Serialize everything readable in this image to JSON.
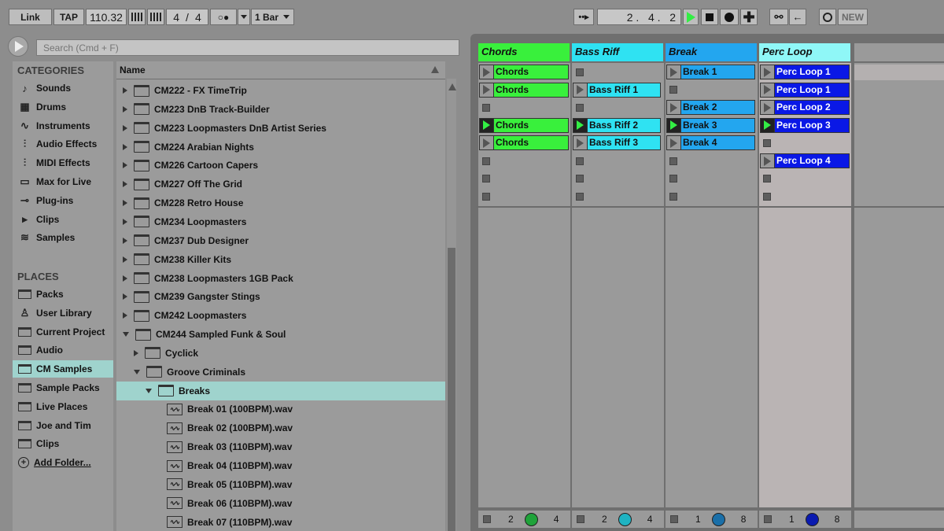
{
  "transport": {
    "link": "Link",
    "tap": "TAP",
    "tempo": "110.32",
    "signature_num": "4",
    "signature_sep": "/",
    "signature_den": "4",
    "quantize": "1 Bar",
    "position": "2 .   4 .   2",
    "new": "NEW"
  },
  "browser": {
    "search_placeholder": "Search (Cmd + F)",
    "categories_title": "CATEGORIES",
    "categories": [
      {
        "label": "Sounds",
        "icon": "♪"
      },
      {
        "label": "Drums",
        "icon": "▦"
      },
      {
        "label": "Instruments",
        "icon": "∿"
      },
      {
        "label": "Audio Effects",
        "icon": "⫶"
      },
      {
        "label": "MIDI Effects",
        "icon": "⫶"
      },
      {
        "label": "Max for Live",
        "icon": "▭"
      },
      {
        "label": "Plug-ins",
        "icon": "⊸"
      },
      {
        "label": "Clips",
        "icon": "▸"
      },
      {
        "label": "Samples",
        "icon": "≋"
      }
    ],
    "places_title": "PLACES",
    "places": [
      {
        "label": "Packs"
      },
      {
        "label": "User Library"
      },
      {
        "label": "Current Project"
      },
      {
        "label": "Audio"
      },
      {
        "label": "CM Samples"
      },
      {
        "label": "Sample Packs"
      },
      {
        "label": "Live Places"
      },
      {
        "label": "Joe and Tim"
      },
      {
        "label": "Clips"
      },
      {
        "label": "Add Folder..."
      }
    ],
    "list_header": "Name",
    "items": [
      {
        "label": "CM222 - FX TimeTrip"
      },
      {
        "label": "CM223 DnB Track-Builder"
      },
      {
        "label": "CM223 Loopmasters DnB Artist Series"
      },
      {
        "label": "CM224 Arabian Nights"
      },
      {
        "label": "CM226 Cartoon Capers"
      },
      {
        "label": "CM227 Off The Grid"
      },
      {
        "label": "CM228 Retro House"
      },
      {
        "label": "CM234 Loopmasters"
      },
      {
        "label": "CM237 Dub Designer"
      },
      {
        "label": "CM238 Killer Kits"
      },
      {
        "label": "CM238 Loopmasters 1GB Pack"
      },
      {
        "label": "CM239 Gangster Stings"
      },
      {
        "label": "CM242 Loopmasters"
      },
      {
        "label": "CM244 Sampled Funk & Soul"
      },
      {
        "label": "Cyclick"
      },
      {
        "label": "Groove Criminals"
      },
      {
        "label": "Breaks"
      },
      {
        "label": "Break 01 (100BPM).wav"
      },
      {
        "label": "Break 02 (100BPM).wav"
      },
      {
        "label": "Break 03 (110BPM).wav"
      },
      {
        "label": "Break 04 (110BPM).wav"
      },
      {
        "label": "Break 05 (110BPM).wav"
      },
      {
        "label": "Break 06 (110BPM).wav"
      },
      {
        "label": "Break 07 (110BPM).wav"
      }
    ]
  },
  "session": {
    "tracks": [
      {
        "name": "Chords",
        "color": "#39f03c",
        "clip_color": "#39f03c",
        "clips": [
          "Chords",
          "Chords",
          "",
          "Chords",
          "Chords",
          "",
          "",
          ""
        ],
        "mixer": {
          "a": "2",
          "b": "4",
          "knob_color": "#1fa33a"
        }
      },
      {
        "name": "Bass Riff",
        "color": "#2fe2f2",
        "clip_color": "#2fe2f2",
        "clips": [
          "",
          "Bass Riff 1",
          "",
          "Bass Riff 2",
          "Bass Riff 3",
          "",
          "",
          ""
        ],
        "mixer": {
          "a": "2",
          "b": "4",
          "knob_color": "#1fb3c2"
        }
      },
      {
        "name": "Break",
        "color": "#23a6ef",
        "clip_color": "#23a6ef",
        "clips": [
          "Break 1",
          "",
          "Break 2",
          "Break 3",
          "Break 4",
          "",
          "",
          ""
        ],
        "mixer": {
          "a": "1",
          "b": "8",
          "knob_color": "#1a6fa8"
        }
      },
      {
        "name": "Perc Loop",
        "color": "#8ff7f7",
        "clip_color": "#0a18e6",
        "clips": [
          "Perc Loop 1",
          "Perc Loop 1",
          "Perc Loop 2",
          "Perc Loop 3",
          "",
          "Perc Loop 4",
          "",
          ""
        ],
        "mixer": {
          "a": "1",
          "b": "8",
          "knob_color": "#0a1ab0"
        }
      }
    ]
  }
}
